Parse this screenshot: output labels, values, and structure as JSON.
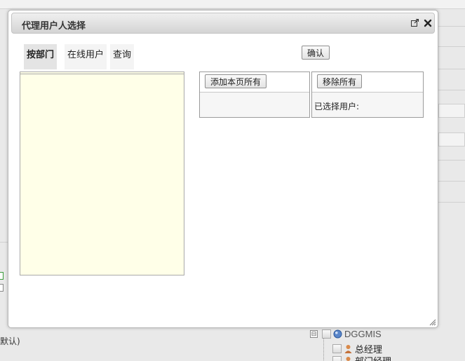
{
  "background": {
    "left_text": "默认)",
    "tree": {
      "root_label": "DGGMIS",
      "root_toggle": "⊟",
      "items": [
        {
          "label": "总经理"
        },
        {
          "label": "部门经理"
        }
      ]
    }
  },
  "dialog": {
    "title": "代理用户人选择",
    "tabs": [
      {
        "label": "按部门",
        "active": true
      },
      {
        "label": "在线用户",
        "active": false
      },
      {
        "label": "查询",
        "active": false
      }
    ],
    "confirm_label": "确认",
    "add_all_label": "添加本页所有",
    "remove_all_label": "移除所有",
    "selected_users_label": "已选择用户:"
  },
  "colors": {
    "tree_panel_bg": "#ffffe8",
    "dialog_bg": "#ffffff",
    "page_bg": "#e9e9e9"
  }
}
